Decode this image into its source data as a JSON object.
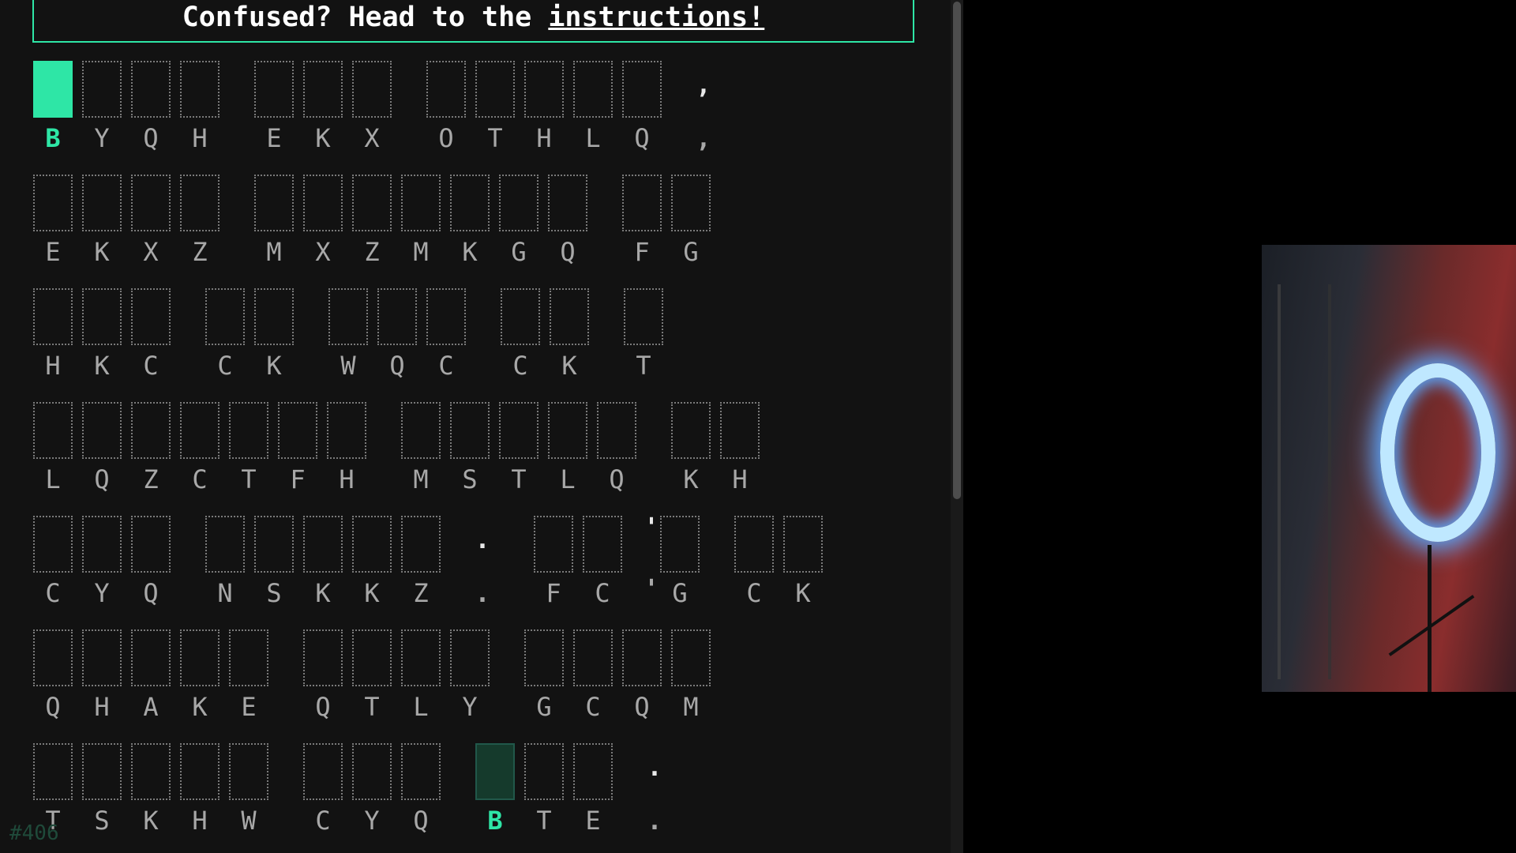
{
  "banner": {
    "prefix": "Confused? Head to the ",
    "link": "instructions!"
  },
  "puzzle_number": "#406",
  "rows": [
    [
      {
        "type": "word",
        "letters": [
          "B",
          "Y",
          "Q",
          "H"
        ]
      },
      {
        "type": "word",
        "letters": [
          "E",
          "K",
          "X"
        ]
      },
      {
        "type": "word",
        "letters": [
          "O",
          "T",
          "H",
          "L",
          "Q"
        ]
      },
      {
        "type": "punct",
        "char": ","
      }
    ],
    [
      {
        "type": "word",
        "letters": [
          "E",
          "K",
          "X",
          "Z"
        ]
      },
      {
        "type": "word",
        "letters": [
          "M",
          "X",
          "Z",
          "M",
          "K",
          "G",
          "Q"
        ]
      },
      {
        "type": "word",
        "letters": [
          "F",
          "G"
        ]
      }
    ],
    [
      {
        "type": "word",
        "letters": [
          "H",
          "K",
          "C"
        ]
      },
      {
        "type": "word",
        "letters": [
          "C",
          "K"
        ]
      },
      {
        "type": "word",
        "letters": [
          "W",
          "Q",
          "C"
        ]
      },
      {
        "type": "word",
        "letters": [
          "C",
          "K"
        ]
      },
      {
        "type": "word",
        "letters": [
          "T"
        ]
      }
    ],
    [
      {
        "type": "word",
        "letters": [
          "L",
          "Q",
          "Z",
          "C",
          "T",
          "F",
          "H"
        ]
      },
      {
        "type": "word",
        "letters": [
          "M",
          "S",
          "T",
          "L",
          "Q"
        ]
      },
      {
        "type": "word",
        "letters": [
          "K",
          "H"
        ]
      }
    ],
    [
      {
        "type": "word",
        "letters": [
          "C",
          "Y",
          "Q"
        ]
      },
      {
        "type": "word",
        "letters": [
          "N",
          "S",
          "K",
          "K",
          "Z"
        ]
      },
      {
        "type": "punct",
        "char": "."
      },
      {
        "type": "word",
        "letters": [
          "F",
          "C",
          "'",
          "G"
        ],
        "apostrophe_index": 2
      },
      {
        "type": "word",
        "letters": [
          "C",
          "K"
        ]
      }
    ],
    [
      {
        "type": "word",
        "letters": [
          "Q",
          "H",
          "A",
          "K",
          "E"
        ]
      },
      {
        "type": "word",
        "letters": [
          "Q",
          "T",
          "L",
          "Y"
        ]
      },
      {
        "type": "word",
        "letters": [
          "G",
          "C",
          "Q",
          "M"
        ]
      }
    ],
    [
      {
        "type": "word",
        "letters": [
          "T",
          "S",
          "K",
          "H",
          "W"
        ]
      },
      {
        "type": "word",
        "letters": [
          "C",
          "Y",
          "Q"
        ]
      },
      {
        "type": "word",
        "letters": [
          "B",
          "T",
          "E"
        ]
      },
      {
        "type": "punct",
        "char": "."
      }
    ]
  ],
  "active_slot": {
    "row": 0,
    "word": 0,
    "letter": 0
  },
  "hint_slots": [
    {
      "row": 6,
      "word": 2,
      "letter": 0
    }
  ],
  "colors": {
    "accent": "#2ee6a6",
    "background": "#121212",
    "glyph": "#a8a8a8"
  }
}
